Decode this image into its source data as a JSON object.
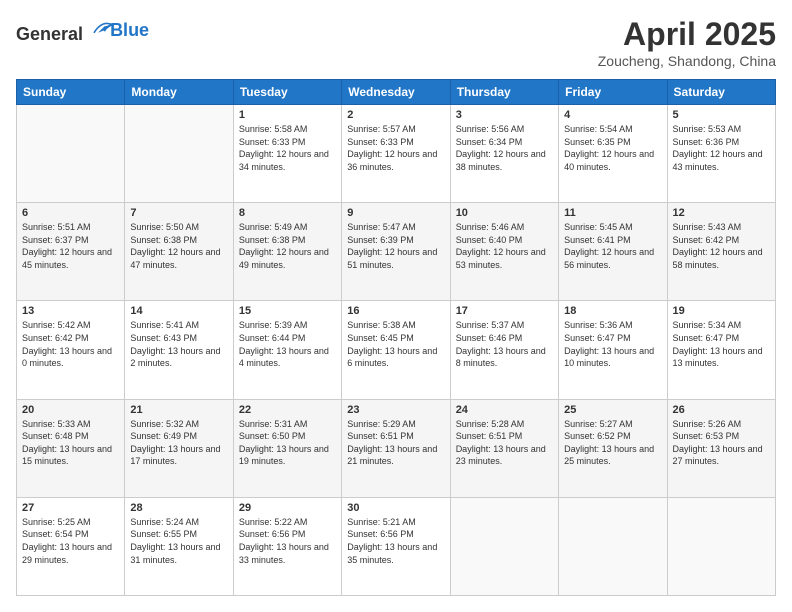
{
  "header": {
    "logo_line1": "General",
    "logo_line2": "Blue",
    "title": "April 2025",
    "subtitle": "Zoucheng, Shandong, China"
  },
  "days_of_week": [
    "Sunday",
    "Monday",
    "Tuesday",
    "Wednesday",
    "Thursday",
    "Friday",
    "Saturday"
  ],
  "weeks": [
    [
      {
        "day": "",
        "info": ""
      },
      {
        "day": "",
        "info": ""
      },
      {
        "day": "1",
        "info": "Sunrise: 5:58 AM\nSunset: 6:33 PM\nDaylight: 12 hours and 34 minutes."
      },
      {
        "day": "2",
        "info": "Sunrise: 5:57 AM\nSunset: 6:33 PM\nDaylight: 12 hours and 36 minutes."
      },
      {
        "day": "3",
        "info": "Sunrise: 5:56 AM\nSunset: 6:34 PM\nDaylight: 12 hours and 38 minutes."
      },
      {
        "day": "4",
        "info": "Sunrise: 5:54 AM\nSunset: 6:35 PM\nDaylight: 12 hours and 40 minutes."
      },
      {
        "day": "5",
        "info": "Sunrise: 5:53 AM\nSunset: 6:36 PM\nDaylight: 12 hours and 43 minutes."
      }
    ],
    [
      {
        "day": "6",
        "info": "Sunrise: 5:51 AM\nSunset: 6:37 PM\nDaylight: 12 hours and 45 minutes."
      },
      {
        "day": "7",
        "info": "Sunrise: 5:50 AM\nSunset: 6:38 PM\nDaylight: 12 hours and 47 minutes."
      },
      {
        "day": "8",
        "info": "Sunrise: 5:49 AM\nSunset: 6:38 PM\nDaylight: 12 hours and 49 minutes."
      },
      {
        "day": "9",
        "info": "Sunrise: 5:47 AM\nSunset: 6:39 PM\nDaylight: 12 hours and 51 minutes."
      },
      {
        "day": "10",
        "info": "Sunrise: 5:46 AM\nSunset: 6:40 PM\nDaylight: 12 hours and 53 minutes."
      },
      {
        "day": "11",
        "info": "Sunrise: 5:45 AM\nSunset: 6:41 PM\nDaylight: 12 hours and 56 minutes."
      },
      {
        "day": "12",
        "info": "Sunrise: 5:43 AM\nSunset: 6:42 PM\nDaylight: 12 hours and 58 minutes."
      }
    ],
    [
      {
        "day": "13",
        "info": "Sunrise: 5:42 AM\nSunset: 6:42 PM\nDaylight: 13 hours and 0 minutes."
      },
      {
        "day": "14",
        "info": "Sunrise: 5:41 AM\nSunset: 6:43 PM\nDaylight: 13 hours and 2 minutes."
      },
      {
        "day": "15",
        "info": "Sunrise: 5:39 AM\nSunset: 6:44 PM\nDaylight: 13 hours and 4 minutes."
      },
      {
        "day": "16",
        "info": "Sunrise: 5:38 AM\nSunset: 6:45 PM\nDaylight: 13 hours and 6 minutes."
      },
      {
        "day": "17",
        "info": "Sunrise: 5:37 AM\nSunset: 6:46 PM\nDaylight: 13 hours and 8 minutes."
      },
      {
        "day": "18",
        "info": "Sunrise: 5:36 AM\nSunset: 6:47 PM\nDaylight: 13 hours and 10 minutes."
      },
      {
        "day": "19",
        "info": "Sunrise: 5:34 AM\nSunset: 6:47 PM\nDaylight: 13 hours and 13 minutes."
      }
    ],
    [
      {
        "day": "20",
        "info": "Sunrise: 5:33 AM\nSunset: 6:48 PM\nDaylight: 13 hours and 15 minutes."
      },
      {
        "day": "21",
        "info": "Sunrise: 5:32 AM\nSunset: 6:49 PM\nDaylight: 13 hours and 17 minutes."
      },
      {
        "day": "22",
        "info": "Sunrise: 5:31 AM\nSunset: 6:50 PM\nDaylight: 13 hours and 19 minutes."
      },
      {
        "day": "23",
        "info": "Sunrise: 5:29 AM\nSunset: 6:51 PM\nDaylight: 13 hours and 21 minutes."
      },
      {
        "day": "24",
        "info": "Sunrise: 5:28 AM\nSunset: 6:51 PM\nDaylight: 13 hours and 23 minutes."
      },
      {
        "day": "25",
        "info": "Sunrise: 5:27 AM\nSunset: 6:52 PM\nDaylight: 13 hours and 25 minutes."
      },
      {
        "day": "26",
        "info": "Sunrise: 5:26 AM\nSunset: 6:53 PM\nDaylight: 13 hours and 27 minutes."
      }
    ],
    [
      {
        "day": "27",
        "info": "Sunrise: 5:25 AM\nSunset: 6:54 PM\nDaylight: 13 hours and 29 minutes."
      },
      {
        "day": "28",
        "info": "Sunrise: 5:24 AM\nSunset: 6:55 PM\nDaylight: 13 hours and 31 minutes."
      },
      {
        "day": "29",
        "info": "Sunrise: 5:22 AM\nSunset: 6:56 PM\nDaylight: 13 hours and 33 minutes."
      },
      {
        "day": "30",
        "info": "Sunrise: 5:21 AM\nSunset: 6:56 PM\nDaylight: 13 hours and 35 minutes."
      },
      {
        "day": "",
        "info": ""
      },
      {
        "day": "",
        "info": ""
      },
      {
        "day": "",
        "info": ""
      }
    ]
  ]
}
